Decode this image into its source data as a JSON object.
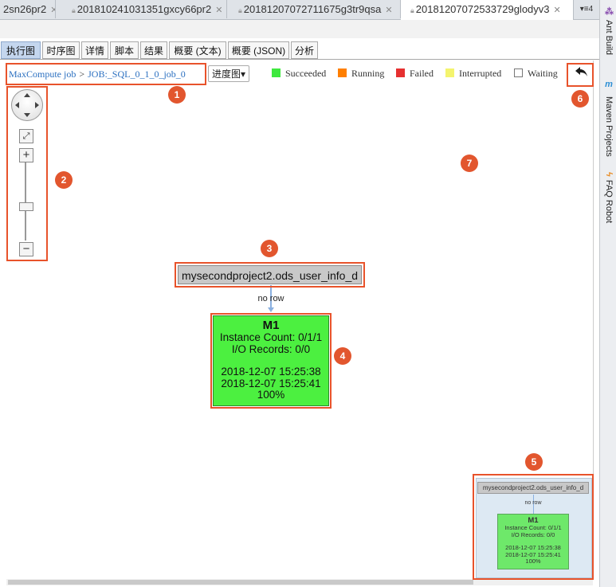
{
  "editor_tabs": [
    {
      "label": "2sn26pr2",
      "locked": false,
      "active": false
    },
    {
      "label": "201810241031351gxcy66pr2",
      "locked": true,
      "active": false
    },
    {
      "label": "20181207072711675g3tr9qsa",
      "locked": true,
      "active": false
    },
    {
      "label": "20181207072533729glodyv3",
      "locked": true,
      "active": true
    }
  ],
  "overflow_count": "4",
  "right_tools": [
    {
      "label": "Ant Build",
      "icon": "ant-icon"
    },
    {
      "label": "Maven Projects",
      "icon": "maven-icon",
      "icon_text": "m"
    },
    {
      "label": "FAQ Robot",
      "icon": "robot-icon"
    }
  ],
  "view_tabs": [
    {
      "label": "执行图",
      "active": true
    },
    {
      "label": "时序图",
      "active": false
    },
    {
      "label": "详情",
      "active": false
    },
    {
      "label": "脚本",
      "active": false
    },
    {
      "label": "结果",
      "active": false
    },
    {
      "label": "概要 (文本)",
      "active": false
    },
    {
      "label": "概要 (JSON)",
      "active": false
    },
    {
      "label": "分析",
      "active": false
    }
  ],
  "breadcrumb": {
    "root": "MaxCompute job",
    "separator": ">",
    "job": "JOB:_SQL_0_1_0_job_0"
  },
  "progress_dropdown": {
    "label": "进度图",
    "arrow": "▾"
  },
  "legend": [
    {
      "label": "Succeeded",
      "color": "#3fe83f"
    },
    {
      "label": "Running",
      "color": "#ff7f00"
    },
    {
      "label": "Failed",
      "color": "#e63030"
    },
    {
      "label": "Interrupted",
      "color": "#f4f46e"
    },
    {
      "label": "Waiting",
      "color": "#ffffff"
    }
  ],
  "graph": {
    "source_table": "mysecondproject2.ods_user_info_d",
    "edge_label": "no row",
    "task": {
      "name": "M1",
      "instance_count": "Instance Count: 0/1/1",
      "io_records": "I/O Records: 0/0",
      "start_time": "2018-12-07 15:25:38",
      "end_time": "2018-12-07 15:25:41",
      "progress": "100%",
      "status_color": "#4cf040"
    }
  },
  "minimap": {
    "source_table": "mysecondproject2.ods_user_info_d",
    "edge_label": "no row",
    "task": {
      "name": "M1",
      "instance_count": "Instance Count: 0/1/1",
      "io_records": "I/O Records: 0/0",
      "start_time": "2018-12-07 15:25:38",
      "end_time": "2018-12-07 15:25:41",
      "progress": "100%"
    }
  },
  "annotations": [
    "1",
    "2",
    "3",
    "4",
    "5",
    "6",
    "7"
  ],
  "accent_color": "#e8532b"
}
